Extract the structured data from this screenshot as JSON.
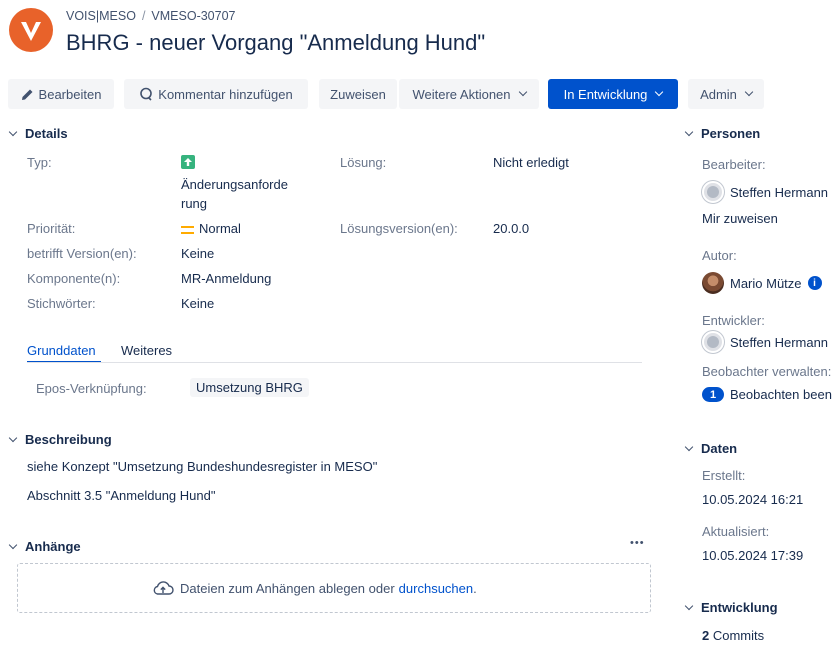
{
  "breadcrumb": {
    "project": "VOIS|MESO",
    "separator": "/",
    "issue_key": "VMESO-30707"
  },
  "issue": {
    "title": "BHRG - neuer Vorgang \"Anmeldung Hund\""
  },
  "toolbar": {
    "edit": "Bearbeiten",
    "comment": "Kommentar hinzufügen",
    "assign": "Zuweisen",
    "more": "Weitere Aktionen",
    "status": "In Entwicklung",
    "admin": "Admin"
  },
  "details": {
    "header": "Details",
    "type_label": "Typ:",
    "type_value_1": "Änderungsanforde",
    "type_value_2": "rung",
    "resolution_label": "Lösung:",
    "resolution_value": "Nicht erledigt",
    "priority_label": "Priorität:",
    "priority_value": "Normal",
    "fix_version_label": "Lösungsversion(en):",
    "fix_version_value": "20.0.0",
    "affects_label": "betrifft Version(en):",
    "affects_value": "Keine",
    "component_label": "Komponente(n):",
    "component_value": "MR-Anmeldung",
    "labels_label": "Stichwörter:",
    "labels_value": "Keine",
    "tabs": [
      "Grunddaten",
      "Weiteres"
    ],
    "epic_label": "Epos-Verknüpfung:",
    "epic_value": "Umsetzung BHRG"
  },
  "description": {
    "header": "Beschreibung",
    "line1": "siehe Konzept \"Umsetzung Bundeshundesregister in MESO\"",
    "line2": "Abschnitt 3.5 \"Anmeldung Hund\""
  },
  "attachments": {
    "header": "Anhänge",
    "more": "•••",
    "drop_text": "Dateien zum Anhängen ablegen oder",
    "browse": "durchsuchen",
    "period": "."
  },
  "people": {
    "header": "Personen",
    "assignee_label": "Bearbeiter:",
    "assignee": "Steffen Hermann",
    "assign_to_me": "Mir zuweisen",
    "reporter_label": "Autor:",
    "reporter": "Mario Mütze",
    "info": "i",
    "developer_label": "Entwickler:",
    "developer": "Steffen Hermann",
    "watchers_label": "Beobachter verwalten:",
    "watch_count": "1",
    "watch_text": "Beobachten been"
  },
  "dates": {
    "header": "Daten",
    "created_label": "Erstellt:",
    "created": "10.05.2024 16:21",
    "updated_label": "Aktualisiert:",
    "updated": "10.05.2024 17:39"
  },
  "development": {
    "header": "Entwicklung",
    "commit_count": "2",
    "commit_label": "Commits"
  },
  "colors": {
    "accent": "#0052cc",
    "brand": "#e8622a",
    "type_icon": "#36b37e",
    "priority": "#ffab00"
  }
}
